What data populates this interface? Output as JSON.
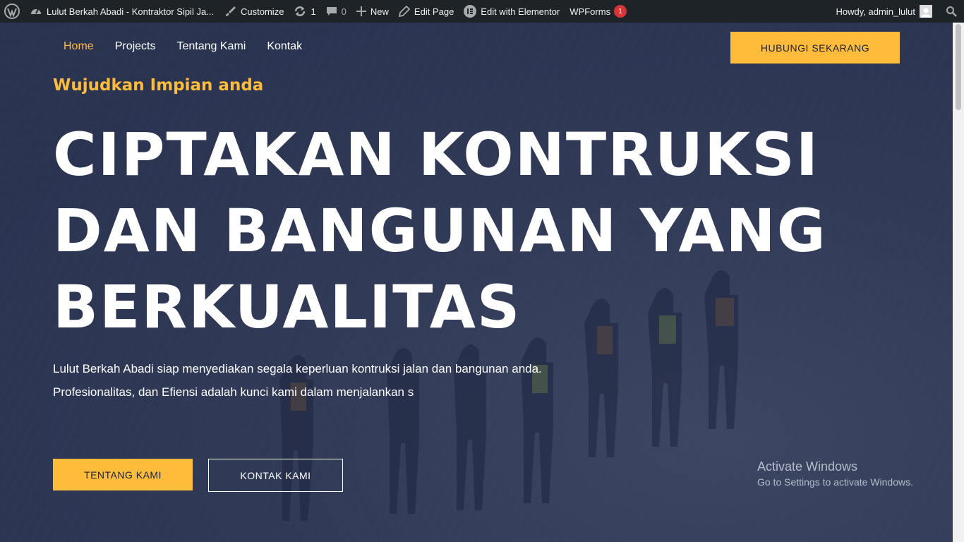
{
  "admin_bar": {
    "site_name": "Lulut Berkah Abadi - Kontraktor Sipil Ja...",
    "customize": "Customize",
    "updates_count": "1",
    "comments_count": "0",
    "new": "New",
    "edit_page": "Edit Page",
    "edit_elementor": "Edit with Elementor",
    "wpforms": "WPForms",
    "wpforms_badge": "1",
    "howdy": "Howdy, admin_lulut"
  },
  "nav": {
    "items": [
      {
        "label": "Home",
        "active": true
      },
      {
        "label": "Projects"
      },
      {
        "label": "Tentang Kami"
      },
      {
        "label": "Kontak"
      }
    ],
    "cta": "HUBUNGI SEKARANG"
  },
  "hero": {
    "kicker": "Wujudkan Impian anda",
    "headline_lines": [
      "CIPTAKAN KONTRUKSI",
      "DAN BANGUNAN YANG",
      "BERKUALITAS"
    ],
    "description_lines": [
      "Lulut Berkah Abadi siap menyediakan segala keperluan kontruksi jalan dan bangunan anda.",
      "Profesionalitas, dan Efiensi adalah kunci kami dalam menjalankan s"
    ],
    "primary_button": "TENTANG KAMI",
    "secondary_button": "KONTAK KAMI"
  },
  "watermark": {
    "title": "Activate Windows",
    "subtitle": "Go to Settings to activate Windows."
  },
  "colors": {
    "accent": "#ffbc3b",
    "admin_bar": "#1d2327",
    "overlay": "#26304e"
  },
  "icons": [
    "wordpress-icon",
    "dashboard-icon",
    "brush-icon",
    "update-icon",
    "comment-icon",
    "plus-icon",
    "pencil-icon",
    "elementor-icon",
    "user-avatar-icon",
    "search-icon"
  ]
}
